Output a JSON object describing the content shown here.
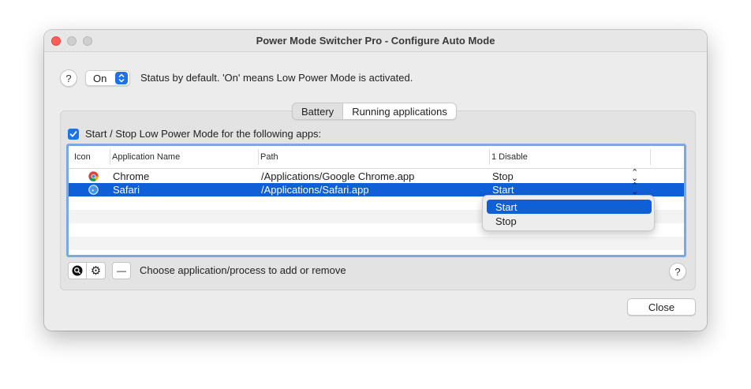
{
  "window": {
    "title": "Power Mode Switcher Pro - Configure Auto Mode"
  },
  "status": {
    "help_label": "?",
    "selected": "On",
    "description": "Status by default. 'On' means Low Power Mode is activated."
  },
  "tabs": [
    {
      "label": "Battery",
      "active": false
    },
    {
      "label": "Running applications",
      "active": true
    }
  ],
  "apps_section": {
    "checkbox_checked": true,
    "checkbox_label": "Start / Stop Low Power Mode for the following apps:",
    "columns": [
      "Icon",
      "Application Name",
      "Path",
      "1 Disable"
    ],
    "rows": [
      {
        "icon": "chrome-icon",
        "name": "Chrome",
        "path": "/Applications/Google Chrome.app",
        "action": "Stop",
        "selected": false
      },
      {
        "icon": "safari-icon",
        "name": "Safari",
        "path": "/Applications/Safari.app",
        "action": "Start",
        "selected": true
      }
    ]
  },
  "dropdown_menu": {
    "items": [
      "Start",
      "Stop"
    ],
    "highlighted": "Start"
  },
  "toolbar": {
    "search_icon": "magnifier-icon",
    "settings_icon": "gear-icon",
    "remove_label": "—",
    "hint": "Choose application/process to add or remove",
    "help_label": "?"
  },
  "footer": {
    "close_label": "Close"
  },
  "colors": {
    "accent": "#0f5fd7",
    "close": "#ff5f57"
  }
}
